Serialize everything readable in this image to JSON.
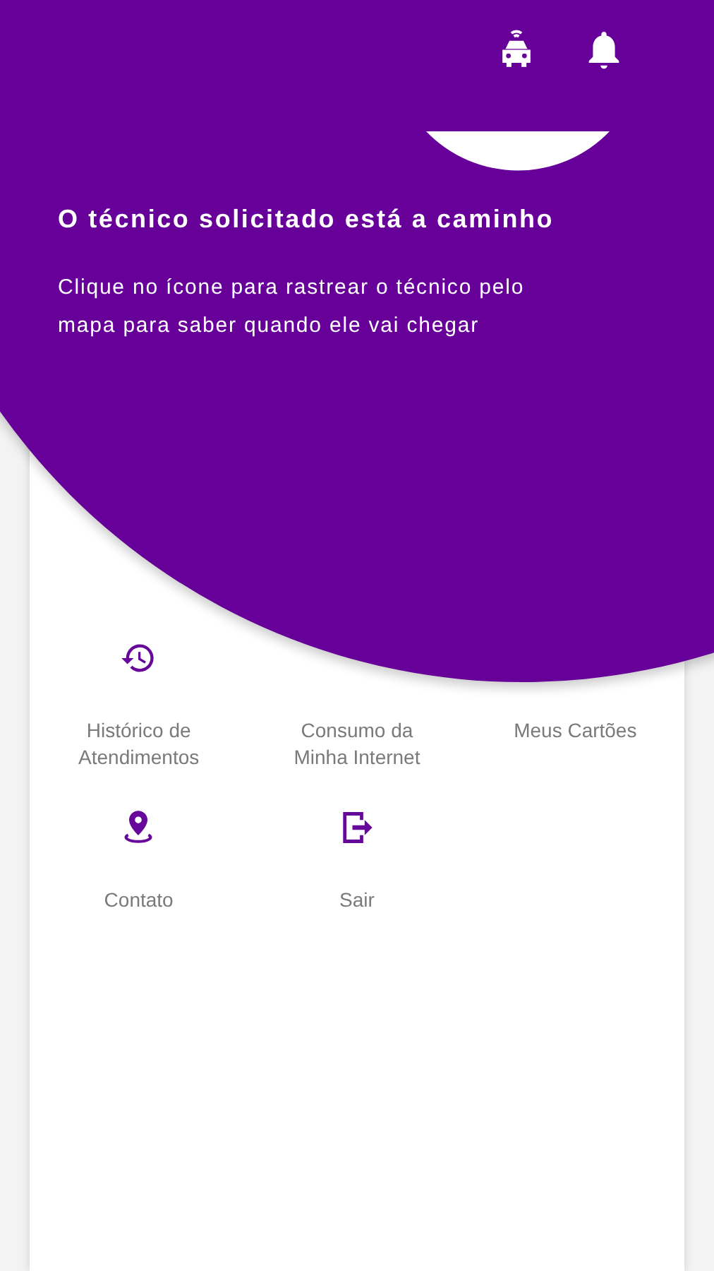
{
  "feature_prompt": {
    "title": "O técnico solicitado está a caminho",
    "description": "Clique no ícone para rastrear o técnico pelo mapa para saber quando ele vai chegar"
  },
  "menu": {
    "items": [
      {
        "label": "Histórico de Atendimentos"
      },
      {
        "label": "Consumo da Minha Internet"
      },
      {
        "label": "Meus Cartões"
      },
      {
        "label": "Contato"
      },
      {
        "label": "Sair"
      }
    ]
  }
}
